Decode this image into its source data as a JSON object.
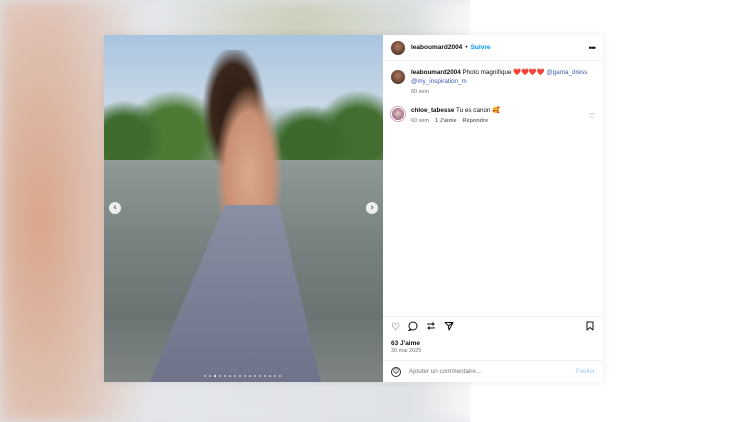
{
  "post": {
    "author": "leaboumard2004",
    "separator": "•",
    "follow_label": "Suivre",
    "more_icon": "more-horizontal-icon"
  },
  "caption": {
    "author": "leaboumard2004",
    "text": "Photo magnifique ❤️❤️❤️❤️",
    "mention1": "@gama_dress",
    "mention2": "@my_inspiration_m",
    "time": "60 sem"
  },
  "comments": [
    {
      "author": "chloe_tabesse",
      "text": "Tu es canon 🥰",
      "time": "60 sem",
      "likes": "1 J'aime",
      "reply_label": "Répondre"
    }
  ],
  "actions": {
    "like_icon": "heart-icon",
    "comment_icon": "comment-icon",
    "share_icon": "repost-icon",
    "send_icon": "send-icon",
    "save_icon": "bookmark-icon"
  },
  "stats": {
    "likes": "63 J'aime",
    "date": "30 mai 2025"
  },
  "add_comment": {
    "placeholder": "Ajouter un commentaire…",
    "publish_label": "Publier"
  },
  "carousel": {
    "prev": "‹",
    "next": "›",
    "slide_count": 16,
    "active_index": 2
  }
}
